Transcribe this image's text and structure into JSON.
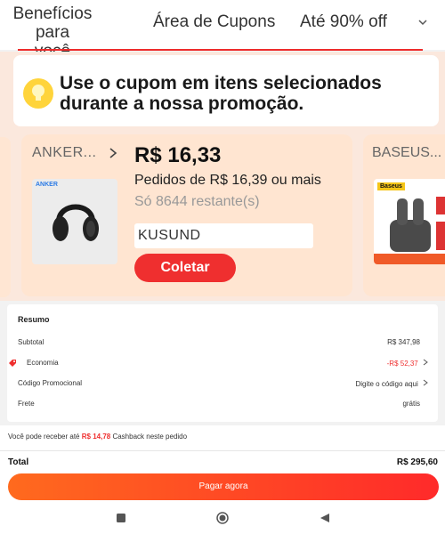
{
  "tabs": [
    {
      "label_line1": "Benefícios para",
      "label_line2": "você"
    },
    {
      "label": "Área de Cupons"
    },
    {
      "label": "Até 90% off"
    }
  ],
  "info": {
    "line1": "Use o cupom em itens selecionados",
    "line2": "durante a nossa promoção."
  },
  "coupon": {
    "brand": "ANKER...",
    "logo_text": "ANKER",
    "price": "R$ 16,33",
    "min_order": "Pedidos de R$ 16,39 ou mais",
    "remaining": "Só 8644 restante(s)",
    "code": "KUSUND",
    "collect_label": "Coletar"
  },
  "coupon2": {
    "brand": "BASEUS...",
    "logo_text": "Baseus"
  },
  "summary": {
    "title": "Resumo",
    "subtotal_label": "Subtotal",
    "subtotal_value": "R$ 347,98",
    "economia_label": "Economia",
    "economia_value": "-R$ 52,37",
    "promo_label": "Código Promocional",
    "promo_value": "Digite o código aqui",
    "frete_label": "Frete",
    "frete_value": "grátis"
  },
  "bottom": {
    "cashback_prefix": "Você pode receber até",
    "cashback_amount": "R$ 14,78",
    "cashback_suffix": "Cashback neste pedido",
    "total_label": "Total",
    "total_value": "R$ 295,60",
    "pay_label": "Pagar agora"
  },
  "colors": {
    "accent": "#ef2f2f",
    "coupon_bg": "#ffe5d1",
    "banner_bg": "#fbe8dd"
  },
  "icons": [
    "chevron-down-icon",
    "lightbulb-icon",
    "chevron-right-icon",
    "tag-icon",
    "square-nav-icon",
    "home-circle-icon",
    "back-triangle-icon"
  ]
}
